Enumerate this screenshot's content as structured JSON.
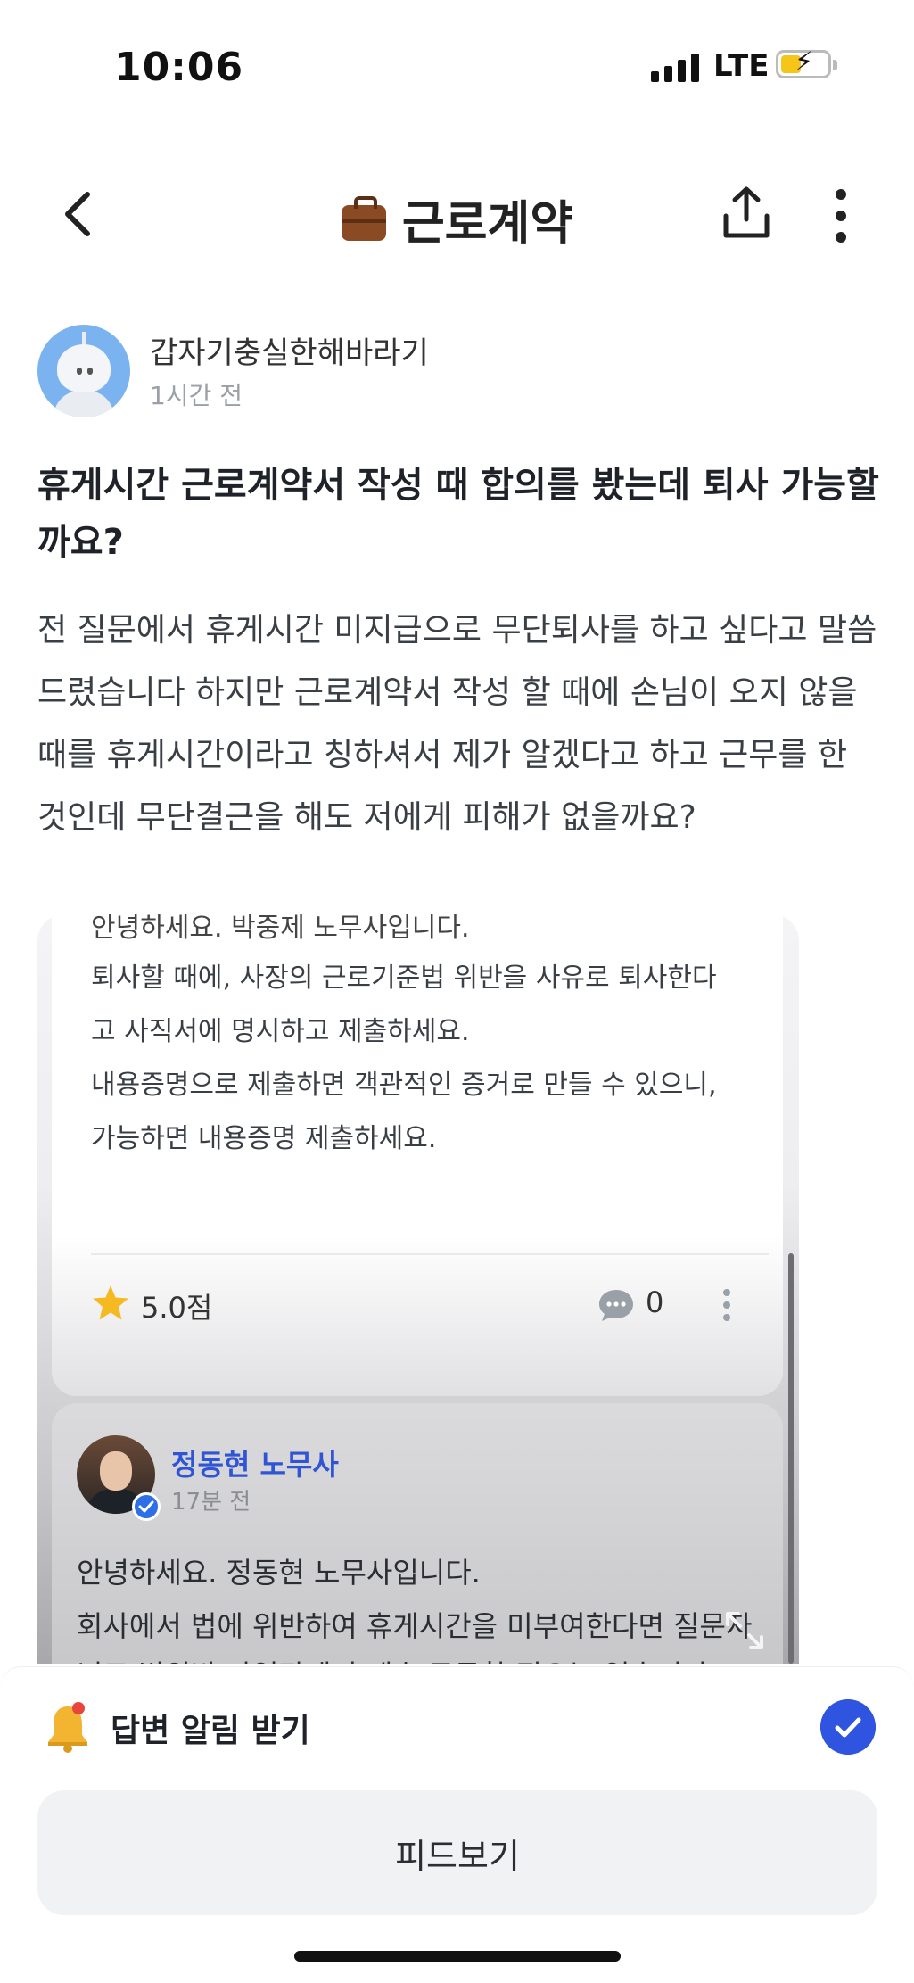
{
  "status_bar": {
    "time": "10:06",
    "network": "LTE"
  },
  "header": {
    "title": "근로계약",
    "category_icon": "briefcase-icon"
  },
  "post": {
    "author": "갑자기충실한해바라기",
    "time": "1시간 전",
    "title": "휴게시간 근로계약서 작성 때 합의를 봤는데 퇴사 가능할까요?",
    "body": "전 질문에서 휴게시간 미지급으로 무단퇴사를 하고 싶다고 말씀 드렸습니다 하지만 근로계약서 작성 할 때에 손님이 오지 않을 때를 휴게시간이라고 칭하셔서 제가 알겠다고 하고 근무를 한 것인데 무단결근을 해도 저에게 피해가 없을까요?"
  },
  "answers": [
    {
      "partial_first_line": "안녕하세요. 박중제 노무사입니다.",
      "lines": [
        "퇴사할 때에, 사장의 근로기준법 위반을 사유로 퇴사한다",
        "고 사직서에 명시하고 제출하세요.",
        "내용증명으로 제출하면 객관적인 증거로 만들 수 있으니,",
        "가능하면 내용증명 제출하세요."
      ],
      "rating": "5.0점",
      "comment_count": "0"
    },
    {
      "author": "정동현 노무사",
      "time": "17분 전",
      "lines": [
        "안녕하세요. 정동현 노무사입니다.",
        "회사에서 법에 위반하여 휴게시간을 미부여한다면 질문자"
      ],
      "partial_last_line": "님도 법위반 사업장에서 계속 근무할 필요는 없습니다."
    }
  ],
  "bottom_sheet": {
    "alert_label": "답변 알림 받기",
    "alert_checked": true,
    "feed_button": "피드보기"
  },
  "colors": {
    "accent": "#2f55e0",
    "lawyer_name": "#2f55d4",
    "star": "#f5b921"
  }
}
